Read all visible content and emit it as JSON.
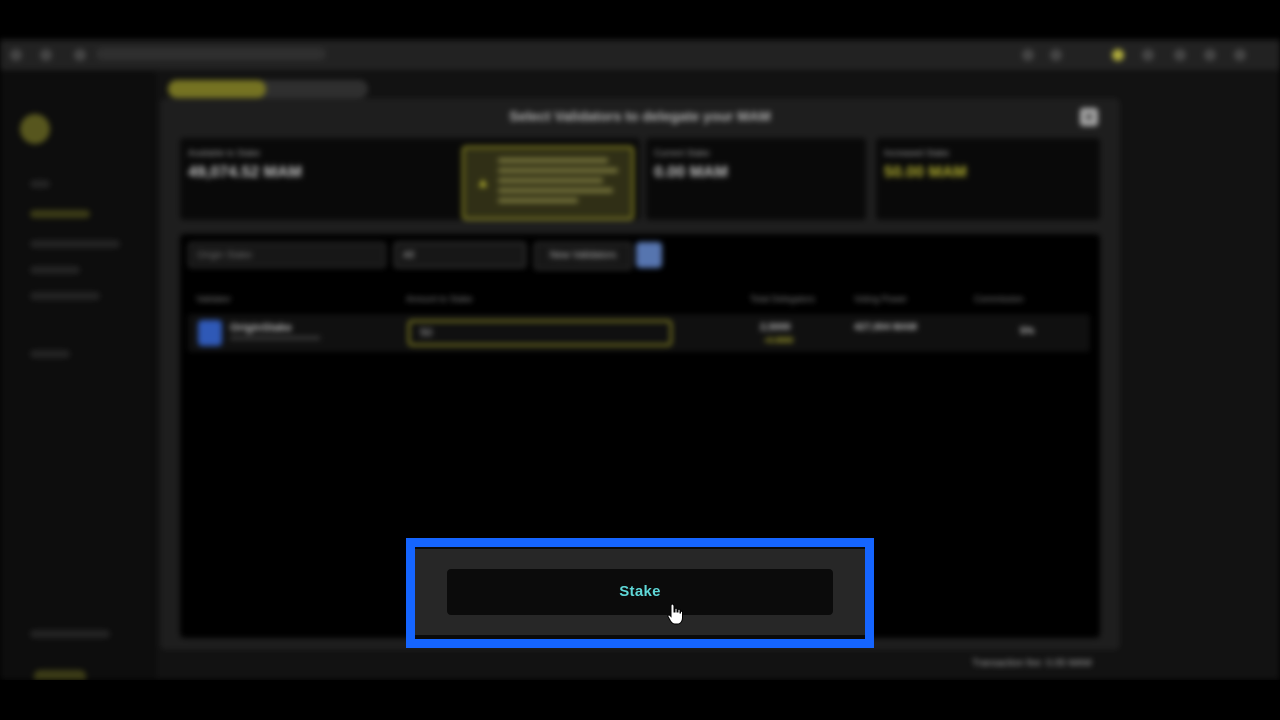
{
  "browser": {
    "url": ""
  },
  "modal": {
    "title": "Select Validators to delegate your MAM",
    "close_label": "✕",
    "stats": {
      "available_label": "Available to Stake",
      "available_value": "49,074.52 MAM",
      "current_label": "Current Stake",
      "current_value": "0.00 MAM",
      "increased_label": "Increased Stake",
      "increased_value": "50.00 MAM"
    },
    "warning_icon": "warning-triangle-icon",
    "toolbar": {
      "search_placeholder": "Origin Stake",
      "select_value": "All",
      "new_validators_label": "New Validators"
    },
    "table": {
      "headers": [
        "Validator",
        "Amount to Stake",
        "Total Delegators",
        "Voting Power",
        "Commission"
      ],
      "rows": [
        {
          "name": "OriginStake",
          "amount": "50",
          "delegators": "2,5000",
          "delegators_change": "+0.0000",
          "voting_power": "427,004 MAM",
          "commission": "5%"
        }
      ]
    },
    "footer_text": "Transaction fee: 0.05 MAM"
  },
  "stake": {
    "button_label": "Stake"
  },
  "colors": {
    "highlight_border": "#1565ff",
    "stake_text": "#5fd8d8",
    "accent_yellow": "#d9d63a"
  }
}
